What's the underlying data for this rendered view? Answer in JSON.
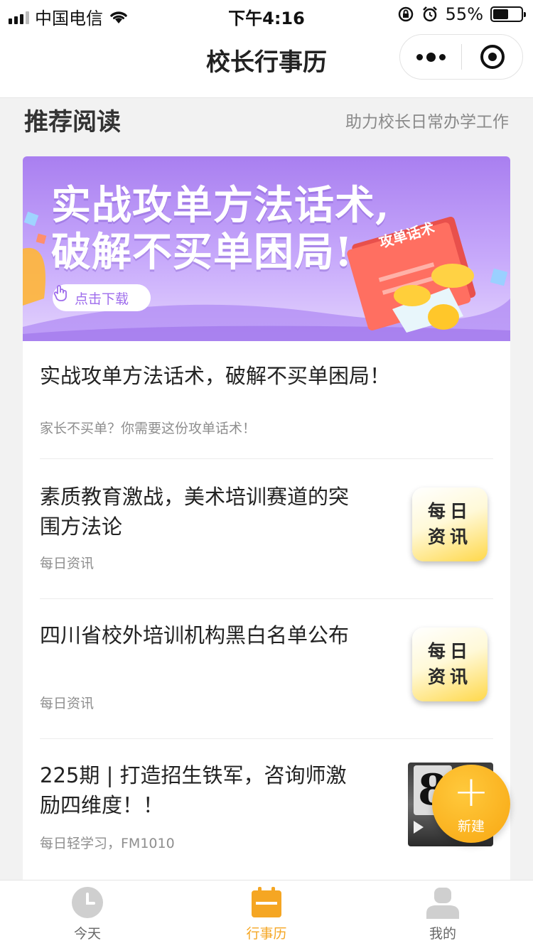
{
  "status_bar": {
    "carrier": "中国电信",
    "time": "下午4:16",
    "battery": "55%",
    "battery_level": 0.55
  },
  "nav": {
    "title": "校长行事历"
  },
  "section": {
    "title": "推荐阅读",
    "subtitle": "助力校长日常办学工作"
  },
  "banner": {
    "line1": "实战攻单方法话术,",
    "line2": "破解不买单困局!",
    "button": "点击下载",
    "book_label": "攻单话术"
  },
  "articles": [
    {
      "title": "实战攻单方法话术，破解不买单困局！",
      "meta": "家长不买单？你需要这份攻单话术！"
    },
    {
      "title": "素质教育激战，美术培训赛道的突围方法论",
      "title_line1": "素质教育激战，美术培训赛道的突",
      "title_line2": "围方法论",
      "meta": "每日资讯",
      "thumb_line1": "每日",
      "thumb_line2": "资讯"
    },
    {
      "title": "四川省校外培训机构黑白名单公布",
      "meta": "每日资讯",
      "thumb_line1": "每日",
      "thumb_line2": "资讯"
    },
    {
      "title": "225期 | 打造招生铁军，咨询师激励四维度！！",
      "title_line1": "225期 | 打造招生铁军，咨询师激",
      "title_line2": "励四维度！！",
      "meta": "每日轻学习，FM1010",
      "thumb_num": "8"
    }
  ],
  "fab": {
    "label": "新建"
  },
  "tabs": [
    {
      "label": "今天",
      "active": false
    },
    {
      "label": "行事历",
      "active": true
    },
    {
      "label": "我的",
      "active": false
    }
  ],
  "colors": {
    "accent": "#f5a623",
    "banner_purple": "#a97ff0"
  }
}
